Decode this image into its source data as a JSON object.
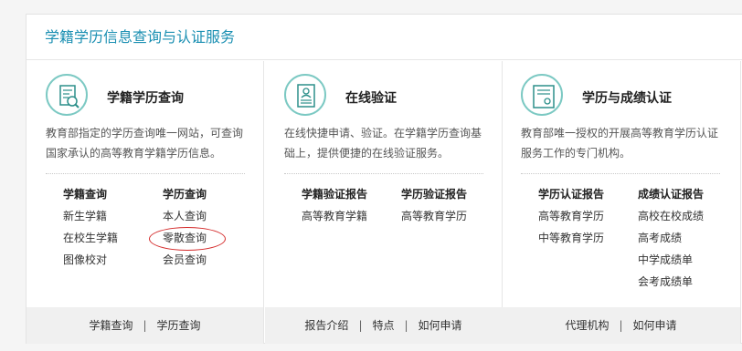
{
  "panel": {
    "title": "学籍学历信息查询与认证服务"
  },
  "columns": [
    {
      "title": "学籍学历查询",
      "icon": "report-search-icon",
      "desc": "教育部指定的学历查询唯一网站，可查询国家承认的高等教育学籍学历信息。",
      "groups": [
        {
          "head": "学籍查询",
          "links": [
            "新生学籍",
            "在校生学籍",
            "图像校对"
          ]
        },
        {
          "head": "学历查询",
          "links": [
            "本人查询",
            "零散查询",
            "会员查询"
          ]
        }
      ],
      "footer": [
        "学籍查询",
        "学历查询"
      ]
    },
    {
      "title": "在线验证",
      "icon": "id-document-icon",
      "desc": "在线快捷申请、验证。在学籍学历查询基础上，提供便捷的在线验证服务。",
      "groups": [
        {
          "head": "学籍验证报告",
          "links": [
            "高等教育学籍"
          ]
        },
        {
          "head": "学历验证报告",
          "links": [
            "高等教育学历"
          ]
        }
      ],
      "footer": [
        "报告介绍",
        "特点",
        "如何申请"
      ]
    },
    {
      "title": "学历与成绩认证",
      "icon": "certificate-icon",
      "desc": "教育部唯一授权的开展高等教育学历认证服务工作的专门机构。",
      "groups": [
        {
          "head": "学历认证报告",
          "links": [
            "高等教育学历",
            "中等教育学历"
          ]
        },
        {
          "head": "成绩认证报告",
          "links": [
            "高校在校成绩",
            "高考成绩",
            "中学成绩单",
            "会考成绩单"
          ]
        }
      ],
      "footer": [
        "代理机构",
        "如何申请"
      ]
    }
  ],
  "colors": {
    "accent": "#1a8fb2",
    "icon_ring": "#7cc9c3",
    "annotation": "#d42a2a"
  }
}
